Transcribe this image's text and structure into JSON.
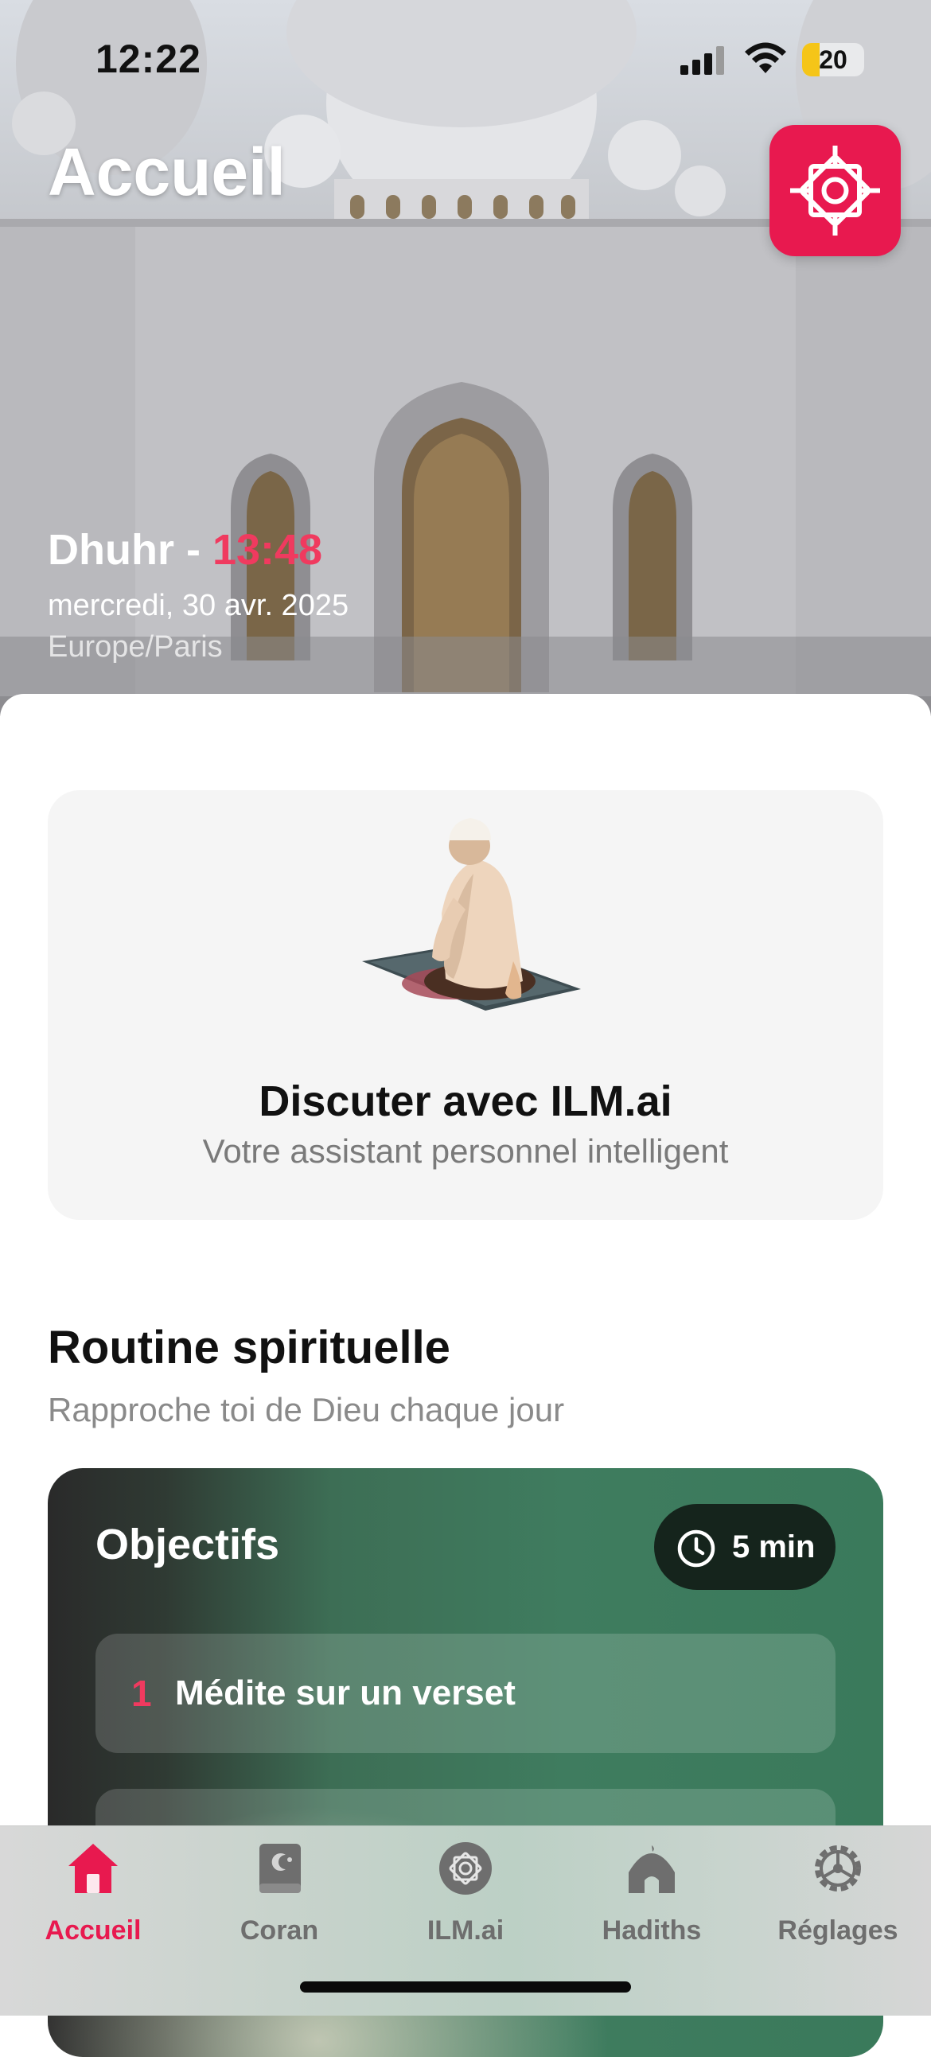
{
  "status_bar": {
    "time": "12:22",
    "battery": "20"
  },
  "header": {
    "title": "Accueil"
  },
  "prayer": {
    "name": "Dhuhr - ",
    "time": "13:48",
    "date": "mercredi, 30 avr. 2025",
    "timezone": "Europe/Paris"
  },
  "chat_card": {
    "title": "Discuter avec ILM.ai",
    "subtitle": "Votre assistant personnel intelligent"
  },
  "routine": {
    "title": "Routine spirituelle",
    "subtitle": "Rapproche toi de Dieu chaque jour",
    "card_title": "Objectifs",
    "duration": "5 min",
    "goals": [
      {
        "number": "1",
        "label": "Médite sur un verset"
      }
    ]
  },
  "tab_bar": {
    "items": [
      {
        "label": "Accueil",
        "icon": "home-icon",
        "active": true
      },
      {
        "label": "Coran",
        "icon": "quran-book-icon",
        "active": false
      },
      {
        "label": "ILM.ai",
        "icon": "ilm-logo-icon",
        "active": false
      },
      {
        "label": "Hadiths",
        "icon": "mosque-icon",
        "active": false
      },
      {
        "label": "Réglages",
        "icon": "settings-gear-icon",
        "active": false
      }
    ]
  },
  "colors": {
    "accent": "#e8194f",
    "prayer_time": "#f03a5f",
    "routine_green": "#3f7c5f"
  }
}
